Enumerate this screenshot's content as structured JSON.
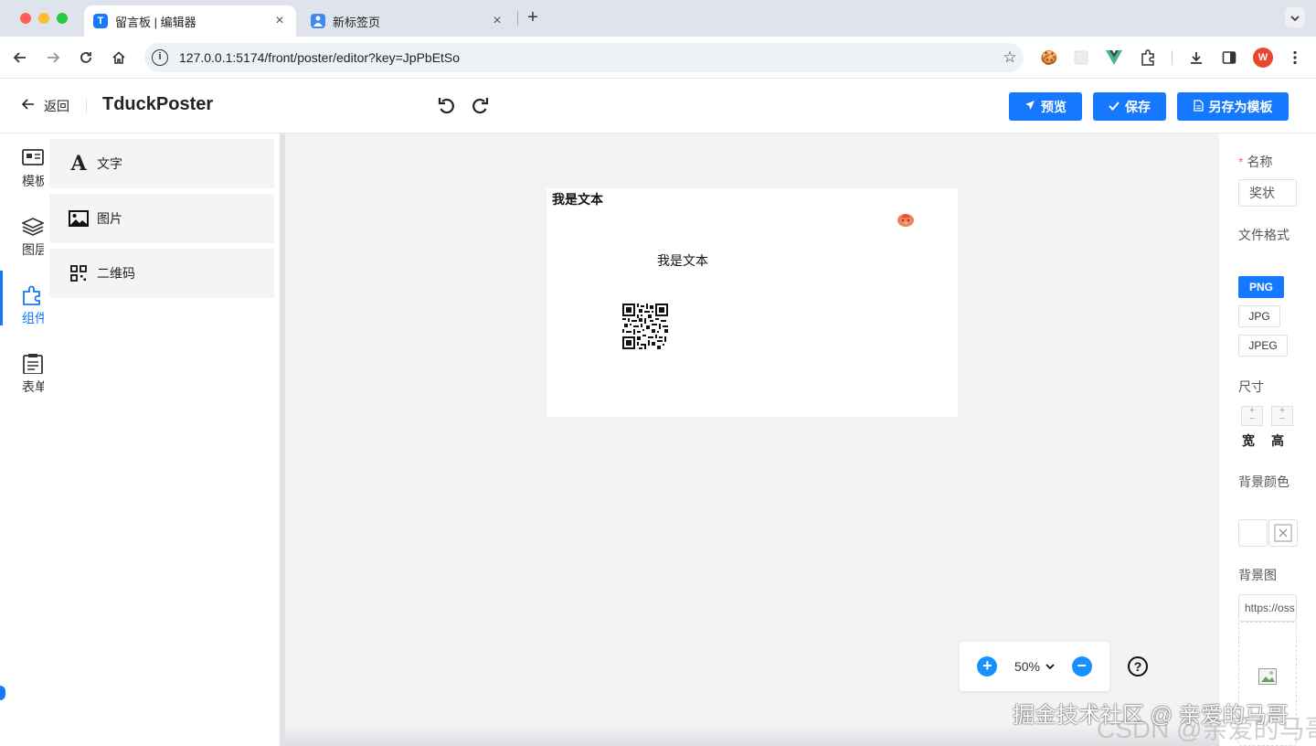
{
  "browser": {
    "tabs": [
      {
        "title": "留言板 | 编辑器",
        "favicon": "T"
      },
      {
        "title": "新标签页",
        "favicon": "user-icon"
      }
    ],
    "new_tab_label": "+",
    "tab_menu_label": "⌄",
    "url": "127.0.0.1:5174/front/poster/editor?key=JpPbEtSo",
    "profile_initial": "W"
  },
  "header": {
    "back_label": "返回",
    "title": "TduckPoster",
    "preview_label": "预览",
    "save_label": "保存",
    "save_template_label": "另存为模板",
    "accent_color": "#1677ff"
  },
  "rail": {
    "items": [
      {
        "label": "模板",
        "icon": "template-icon"
      },
      {
        "label": "图层",
        "icon": "layers-icon"
      },
      {
        "label": "组件",
        "icon": "puzzle-icon",
        "active": true
      },
      {
        "label": "表单",
        "icon": "clipboard-icon"
      }
    ]
  },
  "components": [
    {
      "label": "文字",
      "icon": "text-icon"
    },
    {
      "label": "图片",
      "icon": "image-icon"
    },
    {
      "label": "二维码",
      "icon": "qrcode-icon"
    }
  ],
  "poster": {
    "text_top": "我是文本",
    "text_middle": "我是文本"
  },
  "zoom": {
    "value": "50%",
    "plus": "+",
    "minus": "−",
    "help": "?"
  },
  "props": {
    "name_label": "名称",
    "name_value": "奖状",
    "format_label": "文件格式",
    "formats": [
      "PNG",
      "JPG",
      "JPEG"
    ],
    "selected_format": "PNG",
    "size_label": "尺寸",
    "width_label": "宽",
    "height_label": "高",
    "bg_color_label": "背景颜色",
    "bg_image_label": "背景图",
    "bg_image_value": "https://oss"
  },
  "watermark": {
    "juejin": "掘金技术社区 @ 亲爱的马哥",
    "csdn": "CSDN @亲爱的马哥"
  }
}
